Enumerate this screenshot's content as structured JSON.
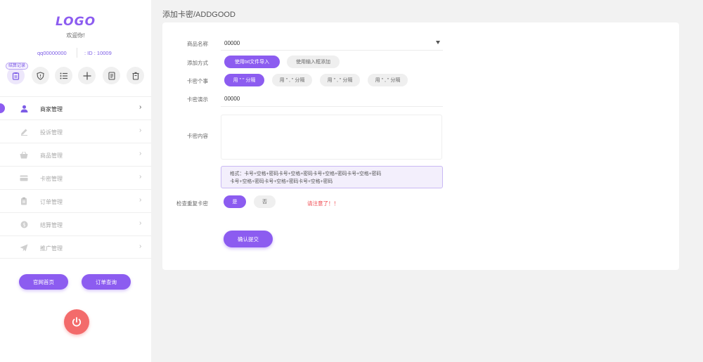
{
  "sidebar": {
    "logo": "LOGO",
    "welcome": "欢迎你!",
    "account": "qq00000000",
    "user_id": ": ID : 10009",
    "quick_tag": "结算记录",
    "quick_icons": [
      "clipboard-icon",
      "shield-icon",
      "list-icon",
      "plus-icon",
      "document-icon",
      "trash-icon"
    ],
    "menu": [
      {
        "label": "商家管理",
        "icon": "user-icon",
        "active": true
      },
      {
        "label": "投诉管理",
        "icon": "pencil-icon",
        "active": false
      },
      {
        "label": "商品管理",
        "icon": "basket-icon",
        "active": false
      },
      {
        "label": "卡密管理",
        "icon": "card-icon",
        "active": false
      },
      {
        "label": "订单管理",
        "icon": "clipboard-icon",
        "active": false
      },
      {
        "label": "结算管理",
        "icon": "coin-icon",
        "active": false
      },
      {
        "label": "推广管理",
        "icon": "paper-plane-icon",
        "active": false
      }
    ],
    "btn_home": "官网首页",
    "btn_order": "订单查询",
    "power_icon": "power-icon"
  },
  "main": {
    "title": "添加卡密/ADDGOOD",
    "form": {
      "product_label": "商品名称",
      "product_value": "00000",
      "method_label": "添加方式",
      "method_opt1": "使用txt文件导入",
      "method_opt2": "使用输入框添加",
      "separator_label": "卡密个事",
      "separator_opts": [
        "用 \" \" 分隔",
        "用 \" , \" 分隔",
        "用 \" , \" 分隔",
        "用 \" , \" 分隔"
      ],
      "demo_label": "卡密演示",
      "demo_value": "00000",
      "content_label": "卡密内容",
      "hint_line1": "格式：卡号+空格+密码卡号+空格+密码卡号+空格+密码卡号+空格+密码",
      "hint_line2": "卡号+空格+密码卡号+空格+密码卡号+空格+密码",
      "dup_label": "检查重复卡密",
      "dup_yes": "是",
      "dup_no": "否",
      "warn": "请注意了！！",
      "submit": "确认提交"
    }
  },
  "colors": {
    "accent": "#8c5cf0",
    "danger": "#f36b6b",
    "warning_text": "#f0494f"
  }
}
